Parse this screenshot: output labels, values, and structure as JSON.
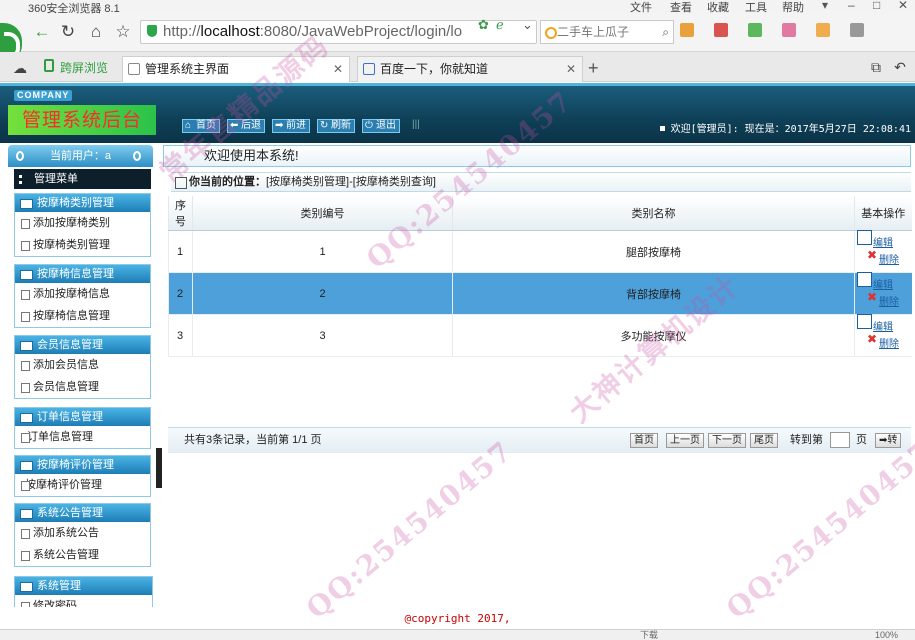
{
  "browser": {
    "app_title": "360安全浏览器 8.1",
    "menu": [
      "文件",
      "查看",
      "收藏",
      "工具",
      "帮助"
    ],
    "url_host": "localhost",
    "url_rest": ":8080/JavaWebProject/login/lo",
    "search_placeholder": "二手车上瓜子",
    "split_view_label": "跨屏浏览",
    "tabs": [
      {
        "label": "管理系统主界面",
        "active": true
      },
      {
        "label": "百度一下，你就知道",
        "active": false
      }
    ],
    "status_items": [
      "下载",
      "100%"
    ]
  },
  "header": {
    "company": "COMPANY",
    "brand": "管理系统后台",
    "toolbar": [
      {
        "icon": "home-icon",
        "label": "首页"
      },
      {
        "icon": "back-arrow-icon",
        "label": "后退"
      },
      {
        "icon": "forward-arrow-icon",
        "label": "前进"
      },
      {
        "icon": "refresh-icon",
        "label": "刷新"
      },
      {
        "icon": "power-icon",
        "label": "退出"
      }
    ],
    "welcome_text": "欢迎[管理员]:   现在是：2017年5月27日 22:08:41"
  },
  "sidebar": {
    "current_user_label": "当前用户：a",
    "menu_title": "管理菜单",
    "groups": [
      {
        "title": "按摩椅类别管理",
        "items": [
          "添加按摩椅类别",
          "按摩椅类别管理"
        ]
      },
      {
        "title": "按摩椅信息管理",
        "items": [
          "添加按摩椅信息",
          "按摩椅信息管理"
        ]
      },
      {
        "title": "会员信息管理",
        "items": [
          "添加会员信息",
          "会员信息管理"
        ]
      },
      {
        "title": "订单信息管理",
        "items": [
          "订单信息管理"
        ]
      },
      {
        "title": "按摩椅评价管理",
        "items": [
          "按摩椅评价管理"
        ]
      },
      {
        "title": "系统公告管理",
        "items": [
          "添加系统公告",
          "系统公告管理"
        ]
      },
      {
        "title": "系统管理",
        "items": [
          "修改密码"
        ]
      }
    ]
  },
  "main": {
    "welcome": "欢迎使用本系统!",
    "location_label": "你当前的位置：",
    "location_path": "[按摩椅类别管理]-[按摩椅类别查询]",
    "columns": [
      "序号",
      "类别编号",
      "类别名称",
      "基本操作"
    ],
    "rows": [
      {
        "seq": "1",
        "code": "1",
        "name": "腿部按摩椅",
        "selected": false
      },
      {
        "seq": "2",
        "code": "2",
        "name": "背部按摩椅",
        "selected": true
      },
      {
        "seq": "3",
        "code": "3",
        "name": "多功能按摩仪",
        "selected": false
      }
    ],
    "edit_label": "编辑",
    "delete_label": "删除",
    "pager": {
      "summary": "共有3条记录，当前第 1/1 页",
      "first": "首页",
      "prev": "上一页",
      "next": "下一页",
      "last": "尾页",
      "goto_label": "转到第",
      "page_unit": "页",
      "go": "转"
    }
  },
  "footer": {
    "copyright": "@copyright 2017,"
  },
  "watermark": {
    "lines": [
      "常年售精品源码",
      "QQ:254540457",
      "大神计算机设计"
    ]
  }
}
